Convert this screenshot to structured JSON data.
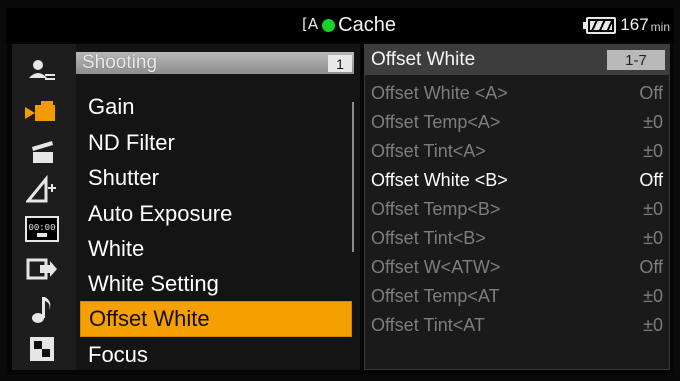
{
  "status": {
    "media_icon": "[A",
    "cache_label": "Cache",
    "battery_value": "167",
    "battery_unit": "min"
  },
  "sidebar": {
    "icons": [
      {
        "name": "user-menu-icon",
        "glyph": "👤"
      },
      {
        "name": "camera-shooting-icon",
        "glyph": "▶▰"
      },
      {
        "name": "clapper-project-icon",
        "glyph": "🎬"
      },
      {
        "name": "paint-adjust-icon",
        "glyph": "◢"
      },
      {
        "name": "timecode-icon",
        "glyph": "00:00"
      },
      {
        "name": "output-icon",
        "glyph": "⇨"
      },
      {
        "name": "audio-note-icon",
        "glyph": "♪"
      },
      {
        "name": "checker-system-icon",
        "glyph": "▦"
      }
    ]
  },
  "menu": {
    "title": "Shooting",
    "page": "1",
    "items": [
      "Gain",
      "ND Filter",
      "Shutter",
      "Auto Exposure",
      "White",
      "White Setting",
      "Offset White",
      "Focus"
    ],
    "selected_index": 6
  },
  "panel": {
    "title": "Offset White",
    "page_range": "1-7",
    "rows": [
      {
        "name": "Offset White <A>",
        "value": "Off"
      },
      {
        "name": "Offset Temp<A>",
        "value": "±0"
      },
      {
        "name": "Offset Tint<A>",
        "value": "±0"
      },
      {
        "name": "Offset White <B>",
        "value": "Off"
      },
      {
        "name": "Offset Temp<B>",
        "value": "±0"
      },
      {
        "name": "Offset Tint<B>",
        "value": "±0"
      },
      {
        "name": "Offset W<ATW>",
        "value": "Off"
      },
      {
        "name": "Offset Temp<AT",
        "value": "±0"
      },
      {
        "name": "Offset Tint<AT",
        "value": "±0"
      }
    ],
    "active_index": 3
  },
  "colors": {
    "accent": "#f5a000",
    "rec": "#17d22a",
    "dimmed": "#7d7d7d"
  }
}
